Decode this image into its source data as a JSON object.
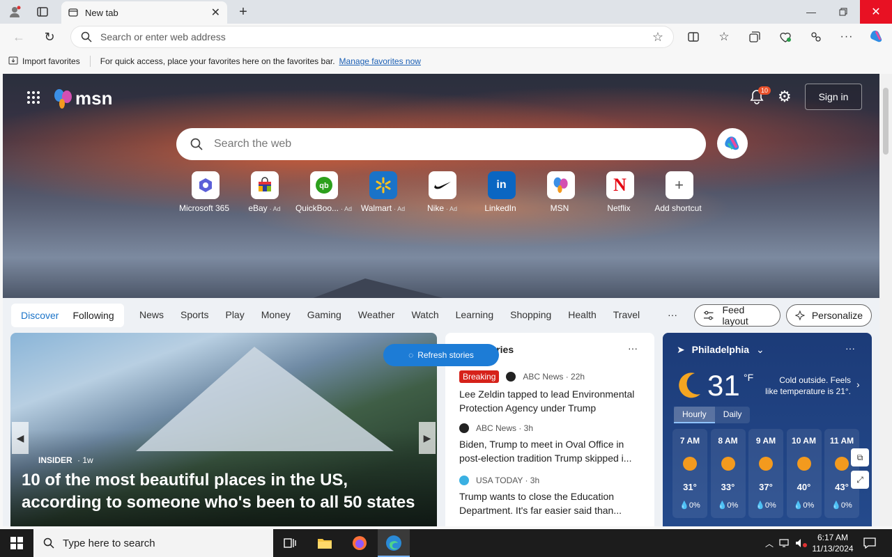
{
  "browser": {
    "tab_title": "New tab",
    "address_placeholder": "Search or enter web address",
    "favorites_bar": {
      "import_label": "Import favorites",
      "message": "For quick access, place your favorites here on the favorites bar.",
      "manage_link": "Manage favorites now"
    }
  },
  "msn": {
    "logo_text": "msn",
    "notification_count": "10",
    "signin_label": "Sign in",
    "search_placeholder": "Search the web",
    "shortcuts": [
      {
        "label": "Microsoft 365",
        "ad": ""
      },
      {
        "label": "eBay",
        "ad": "· Ad"
      },
      {
        "label": "QuickBoo...",
        "ad": "· Ad"
      },
      {
        "label": "Walmart",
        "ad": "· Ad"
      },
      {
        "label": "Nike",
        "ad": "· Ad"
      },
      {
        "label": "LinkedIn",
        "ad": ""
      },
      {
        "label": "MSN",
        "ad": ""
      },
      {
        "label": "Netflix",
        "ad": ""
      },
      {
        "label": "Add shortcut",
        "ad": ""
      }
    ],
    "feed_tabs": [
      "Discover",
      "Following"
    ],
    "nav_links": [
      "News",
      "Sports",
      "Play",
      "Money",
      "Gaming",
      "Weather",
      "Watch",
      "Learning",
      "Shopping",
      "Health",
      "Travel"
    ],
    "more_label": "···",
    "feed_layout_label": "Feed layout",
    "personalize_label": "Personalize",
    "main_story": {
      "source": "INSIDER",
      "age": "· 1w",
      "title": "10 of the most beautiful places in the US, according to someone who's been to all 50 states"
    },
    "top_stories": {
      "heading": "tories",
      "refresh_label": "Refresh stories",
      "items": [
        {
          "tag": "Breaking",
          "source": "ABC News · 22h",
          "headline": "Lee Zeldin tapped to lead Environmental Protection Agency under Trump"
        },
        {
          "tag": "",
          "source": "ABC News · 3h",
          "headline": "Biden, Trump to meet in Oval Office in post-election tradition Trump skipped i..."
        },
        {
          "tag": "",
          "source": "USA TODAY · 3h",
          "headline": "Trump wants to close the Education Department. It's far easier said than..."
        }
      ]
    },
    "weather": {
      "city": "Philadelphia",
      "temp": "31",
      "unit": "°F",
      "description": "Cold outside. Feels like temperature is 21°.",
      "tabs": [
        "Hourly",
        "Daily"
      ],
      "hours": [
        {
          "time": "7 AM",
          "temp": "31°",
          "precip": "💧0%"
        },
        {
          "time": "8 AM",
          "temp": "33°",
          "precip": "💧0%"
        },
        {
          "time": "9 AM",
          "temp": "37°",
          "precip": "💧0%"
        },
        {
          "time": "10 AM",
          "temp": "40°",
          "precip": "💧0%"
        },
        {
          "time": "11 AM",
          "temp": "43°",
          "precip": "💧0%"
        }
      ]
    }
  },
  "taskbar": {
    "search_placeholder": "Type here to search",
    "time": "6:17 AM",
    "date": "11/13/2024"
  }
}
